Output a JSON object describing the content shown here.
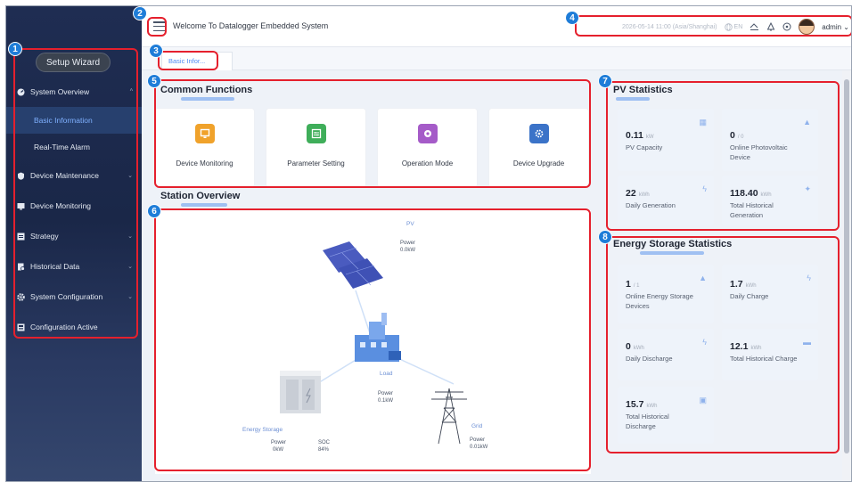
{
  "sidebar": {
    "setup_wizard": "Setup Wizard",
    "items": [
      {
        "label": "System Overview",
        "icon": "dashboard-icon",
        "expanded": true
      },
      {
        "label": "Basic Information",
        "sub": true,
        "active": true
      },
      {
        "label": "Real-Time Alarm",
        "sub": true
      },
      {
        "label": "Device Maintenance",
        "icon": "shield-icon"
      },
      {
        "label": "Device Monitoring",
        "icon": "monitor-icon"
      },
      {
        "label": "Strategy",
        "icon": "strategy-icon"
      },
      {
        "label": "Historical Data",
        "icon": "history-icon"
      },
      {
        "label": "System Configuration",
        "icon": "gear-icon"
      },
      {
        "label": "Configuration Active",
        "icon": "config-icon"
      }
    ]
  },
  "topbar": {
    "welcome": "Welcome To Datalogger Embedded System",
    "datetime": "2026-05-14 11:00 (Asia/Shanghai)",
    "language": "EN",
    "user": "admin"
  },
  "tabs": [
    {
      "label": "Basic Infor..."
    }
  ],
  "common_functions": {
    "title": "Common Functions",
    "items": [
      {
        "label": "Device Monitoring",
        "color": "#f0a22b",
        "icon": "monitor-icon"
      },
      {
        "label": "Parameter Setting",
        "color": "#3fae5a",
        "icon": "settings-panel-icon"
      },
      {
        "label": "Operation Mode",
        "color": "#a55bc8",
        "icon": "mode-icon"
      },
      {
        "label": "Device Upgrade",
        "color": "#3b73c8",
        "icon": "upgrade-icon"
      }
    ]
  },
  "station_overview": {
    "title": "Station Overview",
    "pv": {
      "label": "PV",
      "power_label": "Power",
      "power": "0.0kW"
    },
    "load": {
      "label": "Load",
      "power_label": "Power",
      "power": "0.1kW"
    },
    "grid": {
      "label": "Grid",
      "power_label": "Power",
      "power": "0.01kW"
    },
    "storage": {
      "label": "Energy Storage",
      "power_label": "Power",
      "power": "0kW",
      "soc_label": "SOC",
      "soc": "84%"
    }
  },
  "pv_statistics": {
    "title": "PV Statistics",
    "items": [
      {
        "value": "0.11",
        "unit": "kW",
        "label": "PV Capacity"
      },
      {
        "value": "0",
        "unit": "/ 0",
        "label": "Online Photovoltaic Device"
      },
      {
        "value": "22",
        "unit": "kWh",
        "label": "Daily Generation"
      },
      {
        "value": "118.40",
        "unit": "kWh",
        "label": "Total Historical Generation"
      }
    ]
  },
  "energy_storage_statistics": {
    "title": "Energy Storage Statistics",
    "items": [
      {
        "value": "1",
        "unit": "/ 1",
        "label": "Online Energy Storage Devices"
      },
      {
        "value": "1.7",
        "unit": "kWh",
        "label": "Daily Charge"
      },
      {
        "value": "0",
        "unit": "kWh",
        "label": "Daily Discharge"
      },
      {
        "value": "12.1",
        "unit": "kWh",
        "label": "Total Historical Charge"
      },
      {
        "value": "15.7",
        "unit": "kWh",
        "label": "Total Historical Discharge"
      }
    ]
  },
  "annotations": [
    "1",
    "2",
    "3",
    "4",
    "5",
    "6",
    "7",
    "8"
  ],
  "colors": {
    "annotation_border": "#e5202d",
    "badge": "#1f7dd8",
    "sidebar": "#1f2d52",
    "accent": "#4f8bf5"
  }
}
